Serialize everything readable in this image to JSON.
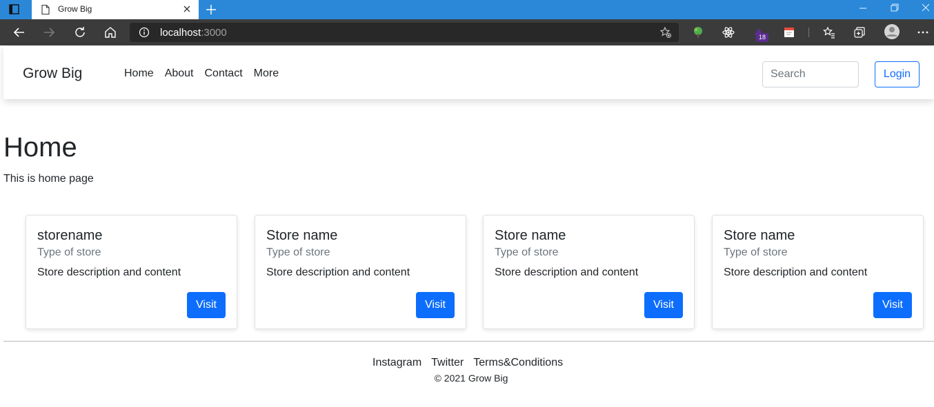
{
  "browser": {
    "tab_title": "Grow Big",
    "address_host": "localhost",
    "address_port": ":3000",
    "extension_badge": "18",
    "accent_color": "#2b88d8"
  },
  "navbar": {
    "brand": "Grow Big",
    "links": [
      "Home",
      "About",
      "Contact",
      "More"
    ],
    "search_placeholder": "Search",
    "login_label": "Login"
  },
  "main": {
    "title": "Home",
    "subtitle": "This is home page"
  },
  "cards": [
    {
      "title": "storename",
      "subtitle": "Type of store",
      "text": "Store description and content",
      "button": "Visit"
    },
    {
      "title": "Store name",
      "subtitle": "Type of store",
      "text": "Store description and content",
      "button": "Visit"
    },
    {
      "title": "Store name",
      "subtitle": "Type of store",
      "text": "Store description and content",
      "button": "Visit"
    },
    {
      "title": "Store name",
      "subtitle": "Type of store",
      "text": "Store description and content",
      "button": "Visit"
    }
  ],
  "footer": {
    "links": [
      "Instagram",
      "Twitter",
      "Terms&Conditions"
    ],
    "copyright": "© 2021 Grow Big"
  },
  "colors": {
    "primary": "#0d6efd",
    "muted": "#6c757d"
  }
}
